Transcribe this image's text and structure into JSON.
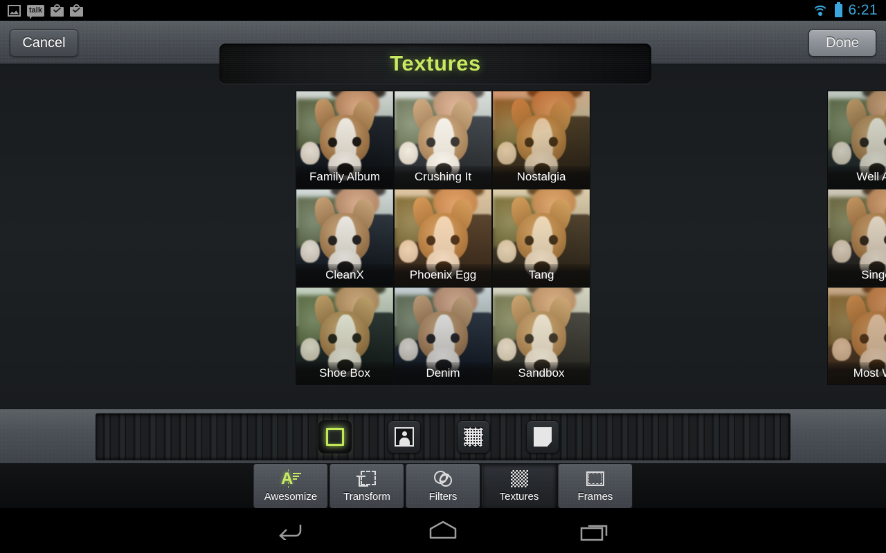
{
  "status_bar": {
    "time": "6:21",
    "left_icons": [
      "gallery-icon",
      "talk-icon",
      "download-complete-icon",
      "download-complete-icon"
    ],
    "right_icons": [
      "wifi-icon",
      "battery-icon"
    ],
    "talk_label": "talk",
    "accent_color": "#3ba7dd"
  },
  "header": {
    "cancel_label": "Cancel",
    "done_label": "Done",
    "title": "Textures",
    "title_color": "#c8ea62"
  },
  "grid": {
    "columns": 3,
    "items": [
      {
        "label": "Family Album",
        "tint": "none"
      },
      {
        "label": "Crushing It",
        "tint": "bright"
      },
      {
        "label": "Nostalgia",
        "tint": "warm"
      },
      {
        "label": "CleanX",
        "tint": "clean"
      },
      {
        "label": "Phoenix Egg",
        "tint": "orange"
      },
      {
        "label": "Tang",
        "tint": "tang"
      },
      {
        "label": "Shoe Box",
        "tint": "green"
      },
      {
        "label": "Denim",
        "tint": "cool"
      },
      {
        "label": "Sandbox",
        "tint": "sand"
      }
    ],
    "offscreen_column": [
      {
        "label": "Well Ag",
        "tint": "aged"
      },
      {
        "label": "Singe",
        "tint": "singe"
      },
      {
        "label": "Most Wa",
        "tint": "warmdeep"
      }
    ]
  },
  "category_strip": {
    "buttons": [
      {
        "name": "square-texture-category",
        "icon": "green-square-icon",
        "selected": true
      },
      {
        "name": "portrait-texture-category",
        "icon": "person-icon",
        "selected": false
      },
      {
        "name": "grunge-texture-category",
        "icon": "grunge-square-icon",
        "selected": false
      },
      {
        "name": "paper-texture-category",
        "icon": "paper-icon",
        "selected": false
      }
    ]
  },
  "tabs": [
    {
      "label": "Awesomize",
      "icon": "awesomize-icon",
      "selected": false
    },
    {
      "label": "Transform",
      "icon": "crop-icon",
      "selected": false
    },
    {
      "label": "Filters",
      "icon": "filters-icon",
      "selected": false
    },
    {
      "label": "Textures",
      "icon": "checkerboard-icon",
      "selected": true
    },
    {
      "label": "Frames",
      "icon": "frame-icon",
      "selected": false
    }
  ],
  "nav_bar": {
    "buttons": [
      {
        "name": "nav-back-button",
        "icon": "back-arrow-icon"
      },
      {
        "name": "nav-home-button",
        "icon": "home-icon"
      },
      {
        "name": "nav-recents-button",
        "icon": "recents-icon"
      }
    ]
  }
}
